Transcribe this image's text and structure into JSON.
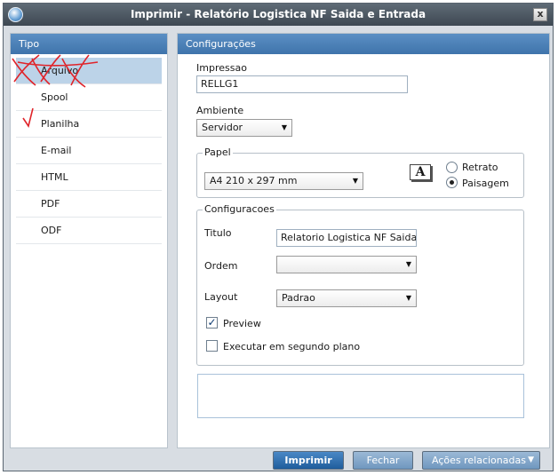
{
  "window": {
    "title": "Imprimir - Relatório Logistica NF Saida e Entrada",
    "close_label": "x"
  },
  "tipo": {
    "header": "Tipo",
    "items": [
      {
        "label": "Arquivo",
        "selected": true
      },
      {
        "label": "Spool",
        "selected": false
      },
      {
        "label": "Planilha",
        "selected": false
      },
      {
        "label": "E-mail",
        "selected": false
      },
      {
        "label": "HTML",
        "selected": false
      },
      {
        "label": "PDF",
        "selected": false
      },
      {
        "label": "ODF",
        "selected": false
      }
    ]
  },
  "config": {
    "header": "Configurações",
    "impressao_label": "Impressao",
    "impressao_value": "RELLG1",
    "ambiente_label": "Ambiente",
    "ambiente_value": "Servidor",
    "papel": {
      "title": "Papel",
      "paper_value": "A4 210 x 297 mm",
      "icon_glyph": "A",
      "orientation_options": [
        "Retrato",
        "Paisagem"
      ],
      "orientation_selected": "Paisagem"
    },
    "configuracoes": {
      "title": "Configuracoes",
      "titulo_label": "Titulo",
      "titulo_value": "Relatorio Logistica NF Saida e E",
      "ordem_label": "Ordem",
      "ordem_value": "",
      "layout_label": "Layout",
      "layout_value": "Padrao",
      "preview_label": "Preview",
      "preview_checked": true,
      "background_label": "Executar em segundo plano",
      "background_checked": false
    }
  },
  "buttons": {
    "imprimir": "Imprimir",
    "fechar": "Fechar",
    "acoes": "Ações relacionadas"
  },
  "colors": {
    "accent": "#3f74ab",
    "scribble": "#e0242a"
  }
}
